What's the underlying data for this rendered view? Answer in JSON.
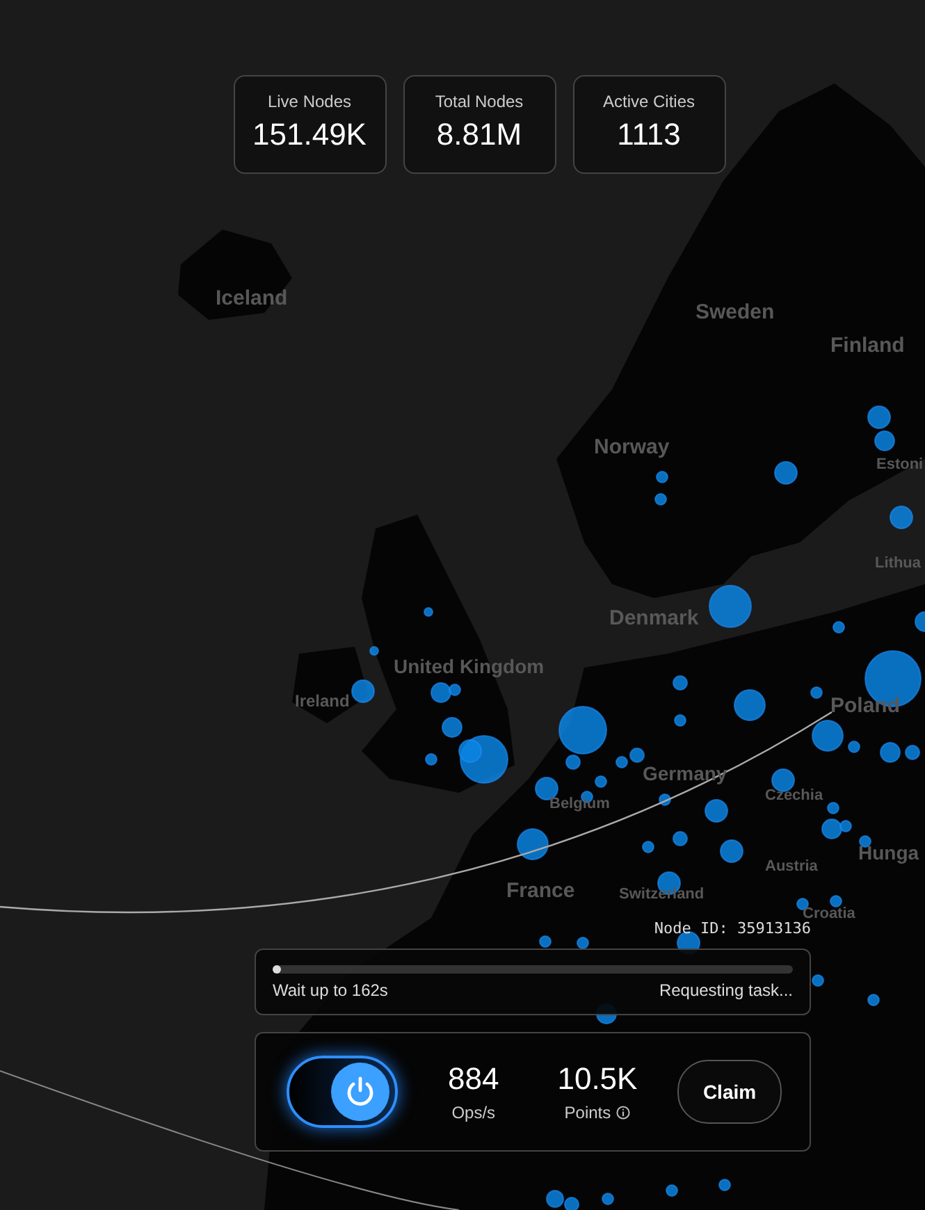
{
  "stats": [
    {
      "label": "Live Nodes",
      "value": "151.49K"
    },
    {
      "label": "Total Nodes",
      "value": "8.81M"
    },
    {
      "label": "Active Cities",
      "value": "1113"
    }
  ],
  "map": {
    "labels": [
      "Iceland",
      "Sweden",
      "Finland",
      "Norway",
      "Estoni",
      "Lithua",
      "Denmark",
      "United Kingdom",
      "Ireland",
      "Germany",
      "Poland",
      "Belgium",
      "Czechia",
      "Austria",
      "Hunga",
      "France",
      "Switzerland",
      "Croatia"
    ]
  },
  "node_id": "Node ID: 35913136",
  "task": {
    "level": 0.01,
    "wait": "Wait up to 162s",
    "status": "Requesting task..."
  },
  "control": {
    "power_on": true,
    "metrics": [
      {
        "value": "884",
        "label": "Ops/s",
        "kind": "plain"
      },
      {
        "value": "10.5K",
        "label": "Points",
        "kind": "info"
      }
    ],
    "claim": "Claim"
  }
}
